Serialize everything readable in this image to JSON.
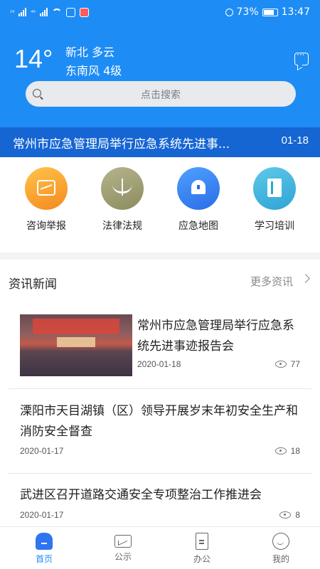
{
  "status_bar": {
    "signal1": "²⁶",
    "signal2": "⁴⁶",
    "battery_percent": "73%",
    "time": "13:47"
  },
  "weather": {
    "temperature": "14°",
    "location_condition": "新北 多云",
    "wind": "东南风 4级"
  },
  "search": {
    "placeholder": "点击搜索"
  },
  "banner": {
    "title": "常州市应急管理局举行应急系统先进事...",
    "date": "01-18"
  },
  "quick_entries": [
    {
      "label": "咨询举报",
      "icon": "photo-icon"
    },
    {
      "label": "法律法规",
      "icon": "scale-icon"
    },
    {
      "label": "应急地图",
      "icon": "siren-icon"
    },
    {
      "label": "学习培训",
      "icon": "book-icon"
    }
  ],
  "news_section": {
    "title": "资讯新闻",
    "more": "更多资讯"
  },
  "news": [
    {
      "title": "常州市应急管理局举行应急系统先进事迹报告会",
      "date": "2020-01-18",
      "views": "77",
      "thumbnail_caption": "先进事迹报告会"
    },
    {
      "title": "溧阳市天目湖镇（区）领导开展岁末年初安全生产和消防安全督查",
      "date": "2020-01-17",
      "views": "18"
    },
    {
      "title": "武进区召开道路交通安全专项整治工作推进会",
      "date": "2020-01-17",
      "views": "8"
    }
  ],
  "tabbar": [
    {
      "label": "首页",
      "active": true
    },
    {
      "label": "公示",
      "active": false
    },
    {
      "label": "办公",
      "active": false
    },
    {
      "label": "我的",
      "active": false
    }
  ],
  "colors": {
    "primary": "#1e8cf5",
    "banner": "#1565d3"
  }
}
